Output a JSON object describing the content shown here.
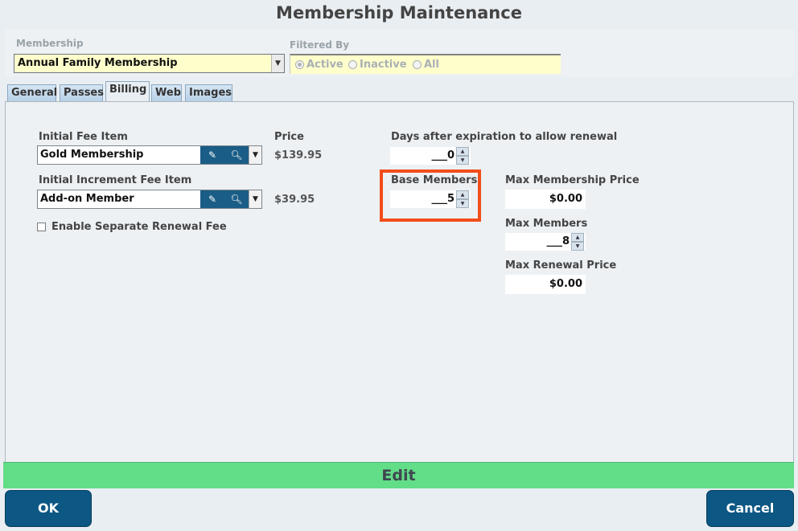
{
  "window": {
    "title": "Membership Maintenance"
  },
  "membership": {
    "label": "Membership",
    "selected": "Annual Family Membership"
  },
  "filter": {
    "label": "Filtered By",
    "options": [
      "Active",
      "Inactive",
      "All"
    ],
    "selected": "Active"
  },
  "tabs": [
    {
      "label": "General"
    },
    {
      "label": "Passes"
    },
    {
      "label": "Billing",
      "active": true
    },
    {
      "label": "Web"
    },
    {
      "label": "Images"
    }
  ],
  "billing": {
    "initial_fee": {
      "label": "Initial Fee Item",
      "value": "Gold Membership",
      "price": "$139.95"
    },
    "increment_fee": {
      "label": "Initial Increment Fee Item",
      "value": "Add-on Member",
      "price": "$39.95"
    },
    "price_label": "Price",
    "separate_renewal": {
      "label": "Enable Separate Renewal Fee",
      "checked": false
    },
    "renewal_days": {
      "label": "Days after expiration to allow renewal",
      "value": "___0"
    },
    "base_members": {
      "label": "Base Members",
      "value": "___5"
    },
    "max_membership_price": {
      "label": "Max Membership Price",
      "value": "$0.00"
    },
    "max_members": {
      "label": "Max Members",
      "value": "___8"
    },
    "max_renewal_price": {
      "label": "Max Renewal Price",
      "value": "$0.00"
    }
  },
  "mode_bar": {
    "label": "Edit"
  },
  "buttons": {
    "ok": "OK",
    "cancel": "Cancel"
  },
  "icons": {
    "edit": "pencil-icon",
    "search": "magnifier-icon",
    "dropdown": "chevron-down-icon",
    "spin_up": "spin-up-icon",
    "spin_down": "spin-down-icon"
  },
  "colors": {
    "field_yellow": "#ffffcc",
    "button_blue": "#0c5783",
    "edit_bar_green": "#62dd88",
    "highlight_orange": "#f24d19"
  }
}
